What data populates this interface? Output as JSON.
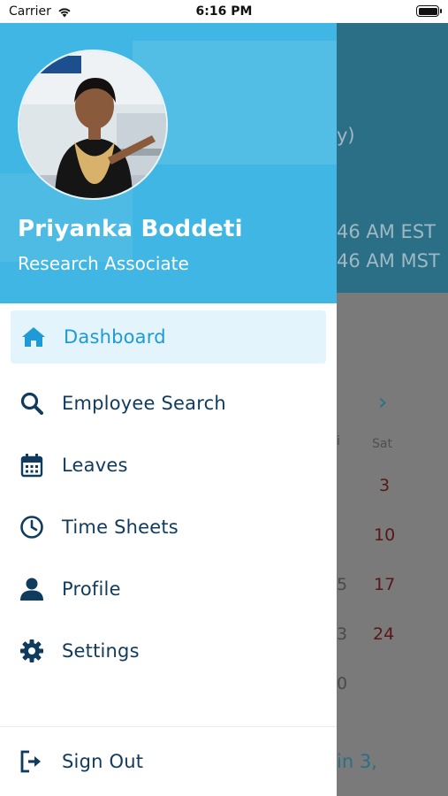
{
  "status_bar": {
    "carrier": "Carrier",
    "time": "6:16 PM"
  },
  "background": {
    "frag_paren": "y)",
    "frag_est": "46 AM EST",
    "frag_mst": "46 AM MST",
    "sat_label": "Sat",
    "fri_frag": "i",
    "dates": [
      "3",
      "10",
      "17",
      "24"
    ],
    "left_frags": [
      "5",
      "3",
      "0"
    ],
    "footer_frag": "in 3,"
  },
  "profile": {
    "name": "Priyanka Boddeti",
    "role": "Research Associate"
  },
  "menu": {
    "items": [
      {
        "label": "Dashboard",
        "icon": "home-icon"
      },
      {
        "label": "Employee Search",
        "icon": "search-icon"
      },
      {
        "label": "Leaves",
        "icon": "calendar-icon"
      },
      {
        "label": "Time Sheets",
        "icon": "clock-icon"
      },
      {
        "label": "Profile",
        "icon": "person-icon"
      },
      {
        "label": "Settings",
        "icon": "gear-icon"
      }
    ],
    "sign_out": {
      "label": "Sign Out",
      "icon": "sign-out-icon"
    }
  },
  "colors": {
    "accent": "#1e9ad6",
    "header_bg": "#3fb6e3",
    "menu_text": "#0f3b5f",
    "active_bg": "#e3f4fc"
  }
}
